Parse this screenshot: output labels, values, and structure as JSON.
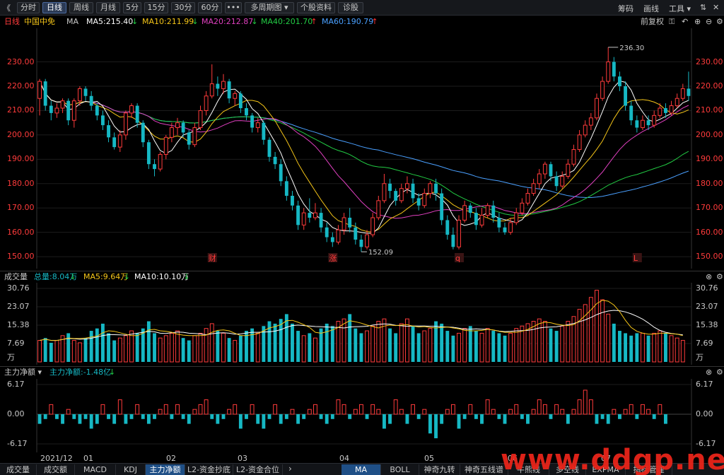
{
  "toolbar": {
    "back": "《",
    "buttons": [
      "分时",
      "日线",
      "周线",
      "月线",
      "5分",
      "15分",
      "30分",
      "60分",
      "•••",
      "多周期图 ▾",
      "个股资料",
      "诊股"
    ],
    "active": "日线",
    "right": [
      "筹码",
      "画线",
      "工具 ▾"
    ],
    "win_icons": [
      "⇅",
      "✕"
    ]
  },
  "main_info": {
    "period": "日线",
    "name": "中国中免",
    "ma_label": "MA",
    "ma": [
      {
        "label": "MA5:215.40",
        "arrow": "↓",
        "color": "#ffffff",
        "arrow_color": "#22cc44"
      },
      {
        "label": "MA10:211.99",
        "arrow": "↓",
        "color": "#f5c518",
        "arrow_color": "#22cc44"
      },
      {
        "label": "MA20:212.87",
        "arrow": "↓",
        "color": "#e040c0",
        "arrow_color": "#22cc44"
      },
      {
        "label": "MA40:201.70",
        "arrow": "↑",
        "color": "#22cc44",
        "arrow_color": "#ff3030"
      },
      {
        "label": "MA60:190.79",
        "arrow": "↑",
        "color": "#4aa0ff",
        "arrow_color": "#ff3030"
      }
    ],
    "right_label": "前复权",
    "icons": [
      "🔒",
      "↶",
      "⊕",
      "⊖",
      "⊕"
    ]
  },
  "price_axis": [
    "230.00",
    "220.00",
    "210.00",
    "200.00",
    "190.00",
    "180.00",
    "170.00",
    "160.00",
    "150.00"
  ],
  "annotations": {
    "high": "236.30",
    "low": "152.09",
    "markers": [
      "财",
      "涨",
      "q",
      "L"
    ]
  },
  "volume_info": {
    "title": "成交量",
    "items": [
      {
        "label": "总量:8.04万",
        "arrow": "↓",
        "color": "#16b8c4"
      },
      {
        "label": "MA5:9.64万",
        "arrow": "↓",
        "color": "#f5c518"
      },
      {
        "label": "MA10:10.10万",
        "arrow": "↓",
        "color": "#ffffff"
      }
    ]
  },
  "volume_axis": [
    "30.76",
    "23.07",
    "15.38",
    "7.69",
    "万"
  ],
  "flow_info": {
    "title": "主力净额 ▾",
    "item": "主力净额:-1.48亿",
    "arrow": "↓"
  },
  "flow_axis": [
    "6.17",
    "0.00",
    "-6.17"
  ],
  "dates": [
    "2021/12",
    "01",
    "02",
    "03",
    "04",
    "05",
    "06",
    "07"
  ],
  "bottom_tabs_left": [
    "成交量",
    "成交额",
    "MACD",
    "KDJ",
    "主力净额",
    "L2-资金抄底",
    "L2-资金合位"
  ],
  "bottom_tabs_right": [
    "MA",
    "BOLL",
    "神奇九转",
    "神奇五线谱",
    "牛熊线",
    "多空线",
    "EXPMA",
    "指标管理"
  ],
  "active_left_tab": "主力净额",
  "active_right_tab": "MA",
  "watermark": "www.ddgp.net",
  "colors": {
    "up": "#ff3b3b",
    "down": "#16b8c4",
    "grid": "#2a2a2a"
  },
  "chart_data": {
    "type": "candlestick",
    "ylim": [
      148,
      238
    ],
    "candles": [
      [
        215,
        222,
        208,
        223
      ],
      [
        222,
        212,
        210,
        223
      ],
      [
        212,
        209,
        206,
        214
      ],
      [
        209,
        211,
        207,
        213
      ],
      [
        211,
        214,
        209,
        215
      ],
      [
        214,
        206,
        204,
        215
      ],
      [
        206,
        214,
        203,
        215
      ],
      [
        214,
        219,
        212,
        220
      ],
      [
        219,
        216,
        214,
        220
      ],
      [
        216,
        212,
        210,
        218
      ],
      [
        212,
        208,
        206,
        213
      ],
      [
        208,
        204,
        202,
        210
      ],
      [
        204,
        199,
        197,
        206
      ],
      [
        199,
        195,
        194,
        201
      ],
      [
        195,
        200,
        193,
        202
      ],
      [
        200,
        209,
        198,
        210
      ],
      [
        209,
        212,
        207,
        213
      ],
      [
        212,
        205,
        203,
        213
      ],
      [
        205,
        197,
        195,
        206
      ],
      [
        197,
        188,
        186,
        198
      ],
      [
        188,
        186,
        183,
        190
      ],
      [
        186,
        192,
        185,
        193
      ],
      [
        192,
        199,
        190,
        200
      ],
      [
        199,
        203,
        197,
        205
      ],
      [
        203,
        205,
        200,
        207
      ],
      [
        205,
        201,
        199,
        206
      ],
      [
        201,
        196,
        194,
        202
      ],
      [
        196,
        203,
        195,
        205
      ],
      [
        203,
        210,
        202,
        212
      ],
      [
        210,
        216,
        208,
        218
      ],
      [
        216,
        221,
        215,
        229
      ],
      [
        221,
        219,
        216,
        224
      ],
      [
        219,
        222,
        217,
        225
      ],
      [
        222,
        215,
        213,
        223
      ],
      [
        215,
        217,
        212,
        218
      ],
      [
        217,
        211,
        209,
        218
      ],
      [
        211,
        208,
        206,
        213
      ],
      [
        208,
        203,
        201,
        209
      ],
      [
        203,
        205,
        201,
        207
      ],
      [
        205,
        198,
        196,
        206
      ],
      [
        198,
        191,
        189,
        199
      ],
      [
        191,
        188,
        186,
        193
      ],
      [
        188,
        181,
        179,
        190
      ],
      [
        181,
        175,
        173,
        183
      ],
      [
        175,
        171,
        169,
        177
      ],
      [
        171,
        163,
        161,
        173
      ],
      [
        163,
        168,
        161,
        170
      ],
      [
        168,
        166,
        164,
        174
      ],
      [
        166,
        168,
        165,
        172
      ],
      [
        168,
        162,
        160,
        170
      ],
      [
        162,
        158,
        156,
        164
      ],
      [
        158,
        156,
        154,
        160
      ],
      [
        156,
        161,
        155,
        163
      ],
      [
        161,
        166,
        159,
        168
      ],
      [
        166,
        162,
        160,
        170
      ],
      [
        162,
        157,
        155,
        164
      ],
      [
        157,
        154,
        152,
        159
      ],
      [
        154,
        159,
        153,
        161
      ],
      [
        159,
        166,
        158,
        168
      ],
      [
        166,
        173,
        165,
        175
      ],
      [
        173,
        180,
        172,
        184
      ],
      [
        180,
        177,
        174,
        182
      ],
      [
        177,
        173,
        171,
        178
      ],
      [
        173,
        178,
        172,
        180
      ],
      [
        178,
        180,
        176,
        183
      ],
      [
        180,
        174,
        172,
        182
      ],
      [
        174,
        171,
        169,
        176
      ],
      [
        171,
        176,
        170,
        178
      ],
      [
        176,
        180,
        174,
        181
      ],
      [
        180,
        176,
        173,
        182
      ],
      [
        176,
        165,
        163,
        178
      ],
      [
        165,
        159,
        157,
        167
      ],
      [
        159,
        154,
        153,
        162
      ],
      [
        154,
        165,
        153,
        167
      ],
      [
        165,
        171,
        164,
        173
      ],
      [
        171,
        168,
        166,
        172
      ],
      [
        168,
        163,
        161,
        170
      ],
      [
        163,
        167,
        162,
        170
      ],
      [
        167,
        171,
        166,
        172
      ],
      [
        171,
        166,
        164,
        173
      ],
      [
        166,
        162,
        160,
        168
      ],
      [
        162,
        160,
        159,
        164
      ],
      [
        160,
        164,
        159,
        166
      ],
      [
        164,
        168,
        163,
        170
      ],
      [
        168,
        172,
        167,
        174
      ],
      [
        172,
        176,
        171,
        178
      ],
      [
        176,
        180,
        175,
        182
      ],
      [
        180,
        184,
        178,
        186
      ],
      [
        184,
        188,
        182,
        189
      ],
      [
        188,
        183,
        181,
        189
      ],
      [
        183,
        179,
        177,
        185
      ],
      [
        179,
        183,
        178,
        185
      ],
      [
        183,
        188,
        182,
        190
      ],
      [
        188,
        194,
        187,
        196
      ],
      [
        194,
        200,
        193,
        202
      ],
      [
        200,
        204,
        199,
        206
      ],
      [
        204,
        207,
        202,
        209
      ],
      [
        207,
        215,
        206,
        217
      ],
      [
        215,
        222,
        214,
        224
      ],
      [
        222,
        230,
        221,
        236
      ],
      [
        230,
        224,
        222,
        232
      ],
      [
        224,
        220,
        218,
        226
      ],
      [
        220,
        212,
        210,
        222
      ],
      [
        212,
        206,
        204,
        214
      ],
      [
        206,
        203,
        201,
        208
      ],
      [
        203,
        206,
        202,
        208
      ],
      [
        206,
        204,
        202,
        208
      ],
      [
        204,
        208,
        203,
        210
      ],
      [
        208,
        211,
        207,
        213
      ],
      [
        211,
        209,
        207,
        213
      ],
      [
        209,
        212,
        208,
        214
      ],
      [
        212,
        215,
        211,
        217
      ],
      [
        215,
        219,
        214,
        221
      ],
      [
        219,
        216,
        214,
        226
      ]
    ],
    "volume": [
      9,
      10,
      8,
      9,
      11,
      12,
      9,
      8,
      10,
      13,
      14,
      16,
      12,
      9,
      10,
      11,
      13,
      12,
      14,
      17,
      12,
      10,
      11,
      12,
      13,
      10,
      9,
      11,
      12,
      14,
      16,
      13,
      12,
      10,
      9,
      11,
      13,
      14,
      12,
      15,
      17,
      16,
      18,
      20,
      16,
      13,
      11,
      12,
      10,
      14,
      16,
      15,
      17,
      18,
      20,
      14,
      12,
      13,
      15,
      17,
      18,
      14,
      12,
      16,
      18,
      15,
      12,
      13,
      14,
      17,
      16,
      13,
      11,
      12,
      14,
      15,
      13,
      12,
      14,
      13,
      12,
      11,
      12,
      14,
      15,
      16,
      17,
      18,
      17,
      14,
      13,
      15,
      17,
      19,
      22,
      24,
      27,
      30,
      26,
      20,
      16,
      13,
      12,
      11,
      12,
      12,
      11,
      12,
      13,
      12,
      11,
      10,
      9
    ],
    "flow": [
      -2,
      -1,
      2,
      -1,
      -2,
      1,
      -1,
      -2,
      -1,
      -3,
      -2,
      2,
      -1,
      -2,
      3,
      -2,
      -1,
      2,
      -1,
      -2,
      -1,
      1,
      2,
      -1,
      2,
      -1,
      -2,
      1,
      2,
      3,
      -1,
      -2,
      -1,
      1,
      2,
      -3,
      -1,
      2,
      -2,
      -3,
      -1,
      2,
      -2,
      -1,
      1,
      -2,
      -1,
      1,
      2,
      -1,
      -2,
      -1,
      3,
      2,
      -1,
      1,
      2,
      -1,
      2,
      1,
      -3,
      -2,
      3,
      1,
      -2,
      2,
      -1,
      1,
      -4,
      -5,
      -2,
      1,
      2,
      -3,
      -1,
      2,
      -1,
      -2,
      3,
      1,
      -1,
      -2,
      1,
      2,
      -1,
      -2,
      1,
      3,
      2,
      -1,
      2,
      1,
      -2,
      1,
      3,
      5,
      3,
      -2,
      -1,
      -2,
      1,
      -1,
      1,
      2,
      -1,
      2,
      1,
      -1,
      2,
      -2
    ]
  }
}
